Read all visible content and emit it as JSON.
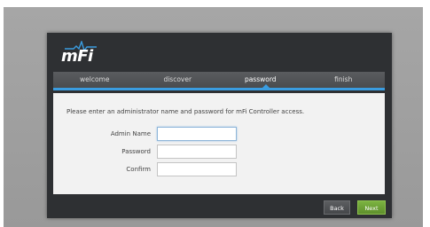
{
  "app": {
    "logo_text": "mFi"
  },
  "tabs": [
    {
      "label": "welcome",
      "active": false
    },
    {
      "label": "discover",
      "active": false
    },
    {
      "label": "password",
      "active": true
    },
    {
      "label": "finish",
      "active": false
    }
  ],
  "form": {
    "instruction": "Please enter an administrator name and password for mFi Controller access.",
    "admin_name": {
      "label": "Admin Name",
      "value": ""
    },
    "password": {
      "label": "Password",
      "value": ""
    },
    "confirm": {
      "label": "Confirm",
      "value": ""
    }
  },
  "buttons": {
    "back_label": "Back",
    "next_label": "Next"
  },
  "colors": {
    "accent": "#3a9ce0",
    "next_button": "#6fa336",
    "dialog_bg": "#2e3033"
  }
}
